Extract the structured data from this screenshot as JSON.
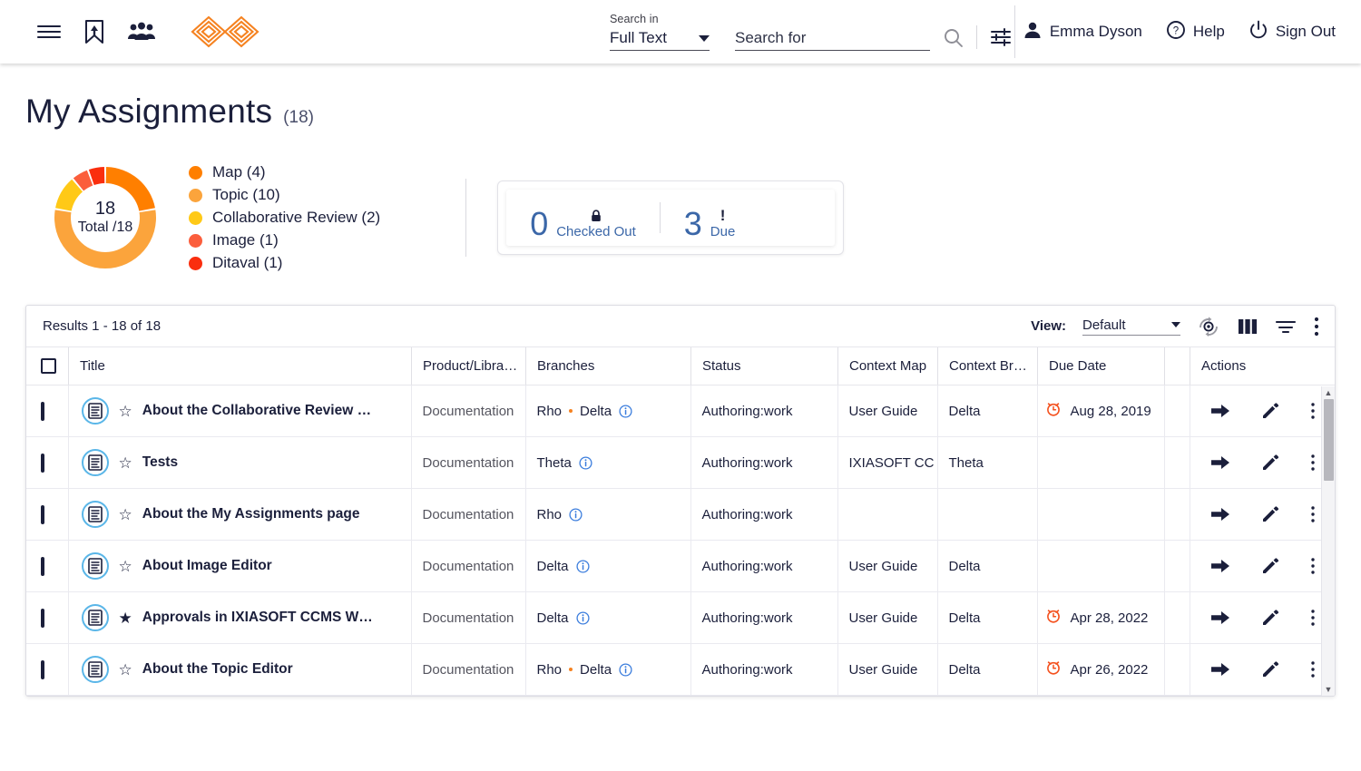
{
  "header": {
    "icons": {
      "menu": "menu-icon",
      "bookmark": "bookmark-icon",
      "people": "people-icon",
      "logo": "ixiasoft-logo"
    },
    "search": {
      "search_in_label": "Search in",
      "search_in_value": "Full Text",
      "search_for_placeholder": "Search for",
      "search_for_value": ""
    },
    "user_name": "Emma Dyson",
    "help_label": "Help",
    "sign_out_label": "Sign Out"
  },
  "page": {
    "title": "My Assignments",
    "count": "(18)"
  },
  "chart_data": {
    "type": "pie",
    "title": "My Assignments",
    "center_total": "18",
    "center_sub": "Total /18",
    "total": 18,
    "legend_position": "right",
    "categories": [
      "Map",
      "Topic",
      "Collaborative Review",
      "Image",
      "Ditaval"
    ],
    "values": [
      4,
      10,
      2,
      1,
      1
    ],
    "colors": [
      "#FF7F00",
      "#FBA43C",
      "#FFC917",
      "#FB5E3C",
      "#FA2E0E"
    ],
    "labels": [
      "Map (4)",
      "Topic (10)",
      "Collaborative Review (2)",
      "Image (1)",
      "Ditaval (1)"
    ]
  },
  "stats": [
    {
      "number": "0",
      "label": "Checked Out",
      "glyph": "lock-icon"
    },
    {
      "number": "3",
      "label": "Due",
      "glyph": "exclamation-icon"
    }
  ],
  "results": {
    "count_text": "Results 1 - 18 of 18",
    "view_label": "View:",
    "view_value": "Default",
    "toolbar_icons": [
      "refresh-icon",
      "columns-icon",
      "filter-icon",
      "more-options-icon"
    ]
  },
  "table": {
    "columns": [
      "Title",
      "Product/Libra…",
      "Branches",
      "Status",
      "Context Map",
      "Context Br…",
      "Due Date",
      "Actions"
    ],
    "rows": [
      {
        "title": "About the Collaborative Review …",
        "starred": false,
        "product": "Documentation",
        "branches": [
          "Rho",
          "Delta"
        ],
        "status": "Authoring:work",
        "context_map": "User Guide",
        "context_branch": "Delta",
        "due_date": "Aug 28, 2019",
        "has_due": true
      },
      {
        "title": "Tests",
        "starred": false,
        "product": "Documentation",
        "branches": [
          "Theta"
        ],
        "status": "Authoring:work",
        "context_map": "IXIASOFT CC",
        "context_branch": "Theta",
        "due_date": "",
        "has_due": false
      },
      {
        "title": "About the My Assignments page",
        "starred": false,
        "product": "Documentation",
        "branches": [
          "Rho"
        ],
        "status": "Authoring:work",
        "context_map": "",
        "context_branch": "",
        "due_date": "",
        "has_due": false
      },
      {
        "title": "About Image Editor",
        "starred": false,
        "product": "Documentation",
        "branches": [
          "Delta"
        ],
        "status": "Authoring:work",
        "context_map": "User Guide",
        "context_branch": "Delta",
        "due_date": "",
        "has_due": false
      },
      {
        "title": "Approvals in IXIASOFT CCMS W…",
        "starred": true,
        "product": "Documentation",
        "branches": [
          "Delta"
        ],
        "status": "Authoring:work",
        "context_map": "User Guide",
        "context_branch": "Delta",
        "due_date": "Apr 28, 2022",
        "has_due": true
      },
      {
        "title": "About the Topic Editor",
        "starred": false,
        "product": "Documentation",
        "branches": [
          "Rho",
          "Delta"
        ],
        "status": "Authoring:work",
        "context_map": "User Guide",
        "context_branch": "Delta",
        "due_date": "Apr 26, 2022",
        "has_due": true
      }
    ],
    "row_actions": [
      "open-arrow-icon",
      "edit-pencil-icon",
      "row-more-options-icon"
    ]
  },
  "colors": {
    "brand_orange": "#F58220",
    "accent_blue": "#3b67a8",
    "doc_icon_blue": "#5ab6e8",
    "due_orange": "#F4511E",
    "text_dark": "#1b1f3b"
  }
}
